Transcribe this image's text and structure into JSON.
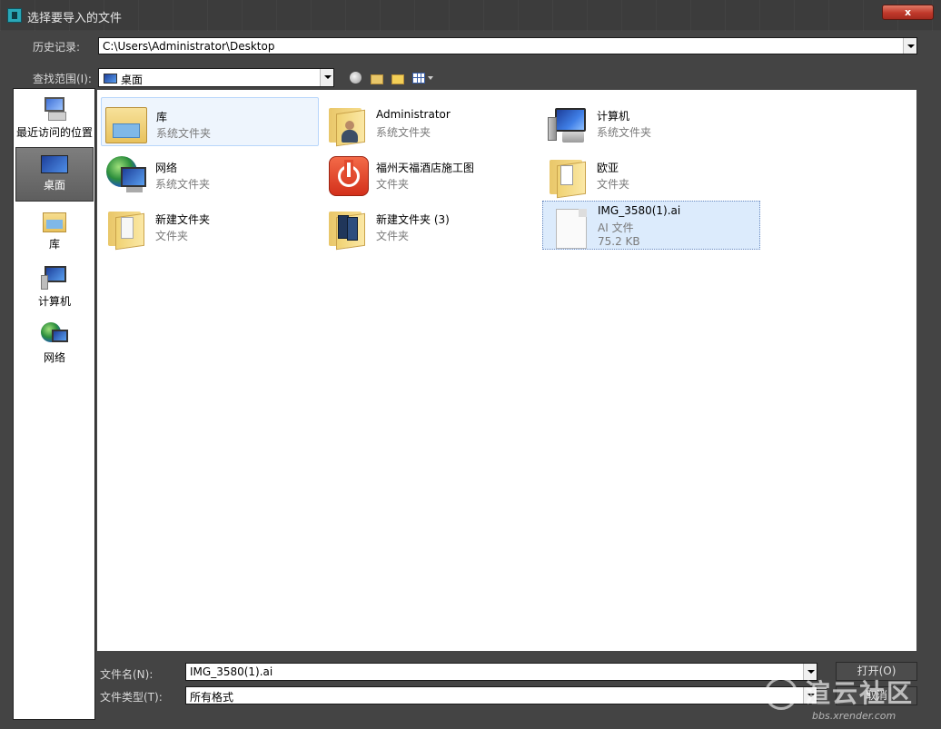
{
  "window": {
    "title": "选择要导入的文件",
    "close_label": "x"
  },
  "history": {
    "label": "历史记录:",
    "value": "C:\\Users\\Administrator\\Desktop"
  },
  "lookin": {
    "label": "查找范围(I):",
    "value": "桌面"
  },
  "nav": {
    "items": [
      {
        "label": "最近访问的位置",
        "icon": "recent-places-icon"
      },
      {
        "label": "桌面",
        "icon": "desktop-icon",
        "selected": true
      },
      {
        "label": "库",
        "icon": "libraries-icon"
      },
      {
        "label": "计算机",
        "icon": "computer-icon"
      },
      {
        "label": "网络",
        "icon": "network-icon"
      }
    ]
  },
  "files": [
    {
      "name": "库",
      "type": "系统文件夹",
      "icon": "libraries-icon"
    },
    {
      "name": "Administrator",
      "type": "系统文件夹",
      "icon": "user-folder-icon"
    },
    {
      "name": "计算机",
      "type": "系统文件夹",
      "icon": "computer-icon"
    },
    {
      "name": "网络",
      "type": "系统文件夹",
      "icon": "network-icon"
    },
    {
      "name": "福州天福酒店施工图",
      "type": "文件夹",
      "icon": "red-app-folder-icon"
    },
    {
      "name": "欧亚",
      "type": "文件夹",
      "icon": "folder-icon"
    },
    {
      "name": "新建文件夹",
      "type": "文件夹",
      "icon": "folder-icon"
    },
    {
      "name": "新建文件夹 (3)",
      "type": "文件夹",
      "icon": "folder-icon"
    },
    {
      "name": "IMG_3580(1).ai",
      "type": "AI 文件",
      "size": "75.2 KB",
      "icon": "document-icon"
    }
  ],
  "filename": {
    "label": "文件名(N):",
    "value": "IMG_3580(1).ai"
  },
  "filetype": {
    "label": "文件类型(T):",
    "value": "所有格式"
  },
  "buttons": {
    "open": "打开(O)",
    "cancel": "取消"
  },
  "watermark": {
    "text": "渲云社区",
    "url": "bbs.xrender.com"
  }
}
